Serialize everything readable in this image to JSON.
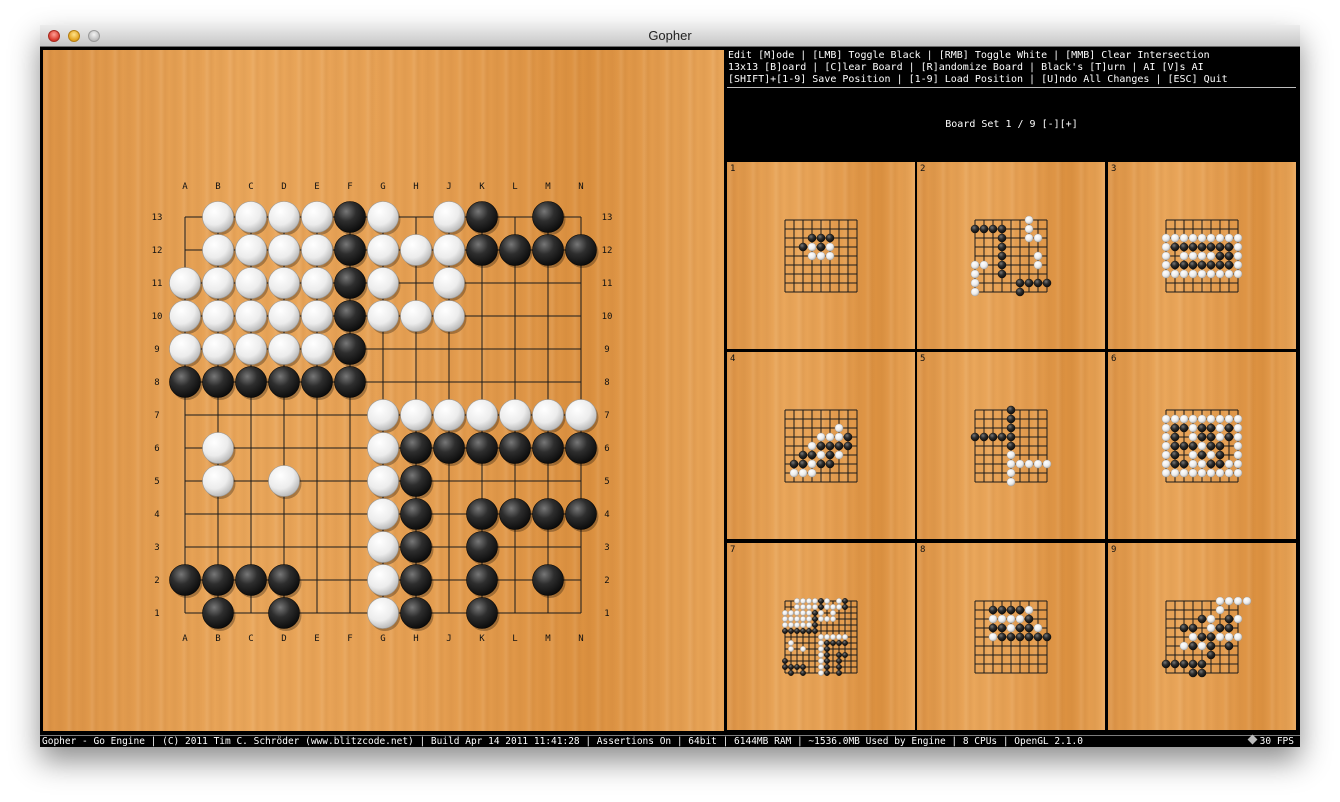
{
  "window": {
    "title": "Gopher"
  },
  "overlay": {
    "command_lines": [
      "Edit [M]ode | [LMB] Toggle Black | [RMB] Toggle White | [MMB] Clear Intersection",
      "13x13 [B]oard | [C]lear Board | [R]andomize Board | Black's [T]urn | AI [V]s AI",
      "[SHIFT]+[1-9] Save Position | [1-9] Load Position | [U]ndo All Changes | [ESC] Quit"
    ],
    "board_set_label": "Board Set 1 / 9 [-][+]"
  },
  "main_board": {
    "size": 13,
    "col_labels": [
      "A",
      "B",
      "C",
      "D",
      "E",
      "F",
      "G",
      "H",
      "J",
      "K",
      "L",
      "M",
      "N"
    ],
    "row_labels": [
      "13",
      "12",
      "11",
      "10",
      "9",
      "8",
      "7",
      "6",
      "5",
      "4",
      "3",
      "2",
      "1"
    ],
    "rows": [
      ".WWWWBW.WB.B.",
      ".WWWWBWWWBBBB",
      "WWWWWBW.W....",
      "WWWWWBWWW....",
      "WWWWWB.......",
      "BBBBBB.......",
      "......WWWWWWW",
      ".W....WBBBBBB",
      ".W.W..WB.....",
      "......WB.BBBB",
      "......WB.B...",
      "BBBB..WB.B.B.",
      ".B.B..WB.B..."
    ]
  },
  "thumbnails": [
    {
      "label": "1",
      "rows": [
        ".........",
        ".........",
        "...BBB...",
        "..BWBW...",
        "...WWW...",
        ".........",
        ".........",
        ".........",
        "........."
      ]
    },
    {
      "label": "2",
      "rows": [
        "......W..",
        "BBBB..W..",
        "...B..WW.",
        "...B.....",
        "...B...W.",
        "WW.B...W.",
        "W..B.....",
        "W....BBBB",
        "W....B..."
      ]
    },
    {
      "label": "3",
      "rows": [
        ".........",
        ".........",
        "WWWWWWWWW",
        "WBBBBBBBW",
        "W.WWWWBBW",
        "WBBBBBBBW",
        "WWWWWWWWW",
        ".........",
        "........."
      ]
    },
    {
      "label": "4",
      "rows": [
        ".........",
        ".........",
        "......W..",
        "....WWWB.",
        "...WBBBB.",
        "..BBWBW..",
        ".BBWBB...",
        ".WWW.....",
        "........."
      ]
    },
    {
      "label": "5",
      "rows": [
        "....B....",
        "....B....",
        "....B....",
        "BBBBB....",
        "....B....",
        "....W....",
        "....WWWWW",
        "....W....",
        "....W...."
      ]
    },
    {
      "label": "6",
      "rows": [
        ".........",
        "WWWWWWWWW",
        "WBBWBBWBW",
        "WB.WBBWBW",
        "WBBBWBB.W",
        "WB.WBWB.W",
        "WBBWWBBWW",
        "WWWWWWWWW",
        "........."
      ]
    },
    {
      "label": "7",
      "rows": [
        "..WWWWBW.WB",
        "..WWWWBWWWB",
        "WWWWWBW.W..",
        "WWWWWBWWW..",
        "WWWWWB.....",
        "BBBBBB.....",
        "......WWWWW",
        ".W....WBBBB",
        ".W.W..WB...",
        "......WB.BB",
        "B.....WB.B.",
        "BBBB..WB.B.",
        ".B.B..WB.B."
      ]
    },
    {
      "label": "8",
      "rows": [
        ".........",
        "..BBBBW..",
        "..WWWWB..",
        "..BBWBBW.",
        "..WBBBBBB",
        ".........",
        ".........",
        ".........",
        "........."
      ]
    },
    {
      "label": "9",
      "rows": [
        "......WWWW",
        "......W...",
        "....BW.BW.",
        "..BB.WBB..",
        "...WBBWWW.",
        "..WBWB.B..",
        ".....B....",
        "BBBBB.....",
        "...BB....."
      ]
    }
  ],
  "statusbar": {
    "text": "Gopher - Go Engine | (C) 2011 Tim C. Schröder (www.blitzcode.net) | Build Apr 14 2011 11:41:28 | Assertions On | 64bit | 6144MB RAM | ~1536.0MB Used by Engine | 8 CPUs | OpenGL 2.1.0",
    "fps": "30 FPS"
  },
  "colors": {
    "wood": "#e39d4e",
    "grid": "#1a1a1a",
    "black_stone": "#222222",
    "white_stone": "#f2f2f2",
    "background": "#000000"
  }
}
